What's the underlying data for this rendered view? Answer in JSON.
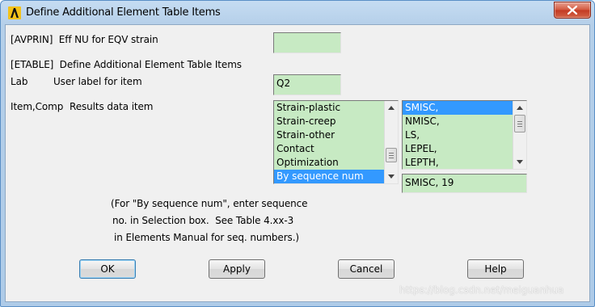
{
  "window": {
    "title": "Define Additional Element Table Items"
  },
  "avprin": {
    "label": "[AVPRIN]  Eff NU for EQV strain",
    "value": ""
  },
  "etable": {
    "label": "[ETABLE]  Define Additional Element Table Items"
  },
  "lab": {
    "key": "Lab",
    "label": "User label for item",
    "value": "Q2"
  },
  "itemcomp": {
    "key": "Item,Comp",
    "label": "Results data item",
    "left_items": [
      "Strain-plastic",
      "Strain-creep",
      "Strain-other",
      "Contact",
      "Optimization",
      "By sequence num"
    ],
    "left_selected": "By sequence num",
    "right_items": [
      "SMISC,",
      "NMISC,",
      "LS,",
      "LEPEL,",
      "LEPTH,"
    ],
    "right_selected": "SMISC,",
    "selection_value": "SMISC, 19"
  },
  "note": {
    "line1": "(For \"By sequence num\", enter sequence",
    "line2": "no. in Selection box.  See Table 4.xx-3",
    "line3": "in Elements Manual for seq. numbers.)"
  },
  "buttons": {
    "ok": "OK",
    "apply": "Apply",
    "cancel": "Cancel",
    "help": "Help"
  },
  "watermark": "https://blog.csdn.net/meiguanhua",
  "colors": {
    "field_bg": "#c7eac3",
    "selection": "#3399ff",
    "client_bg": "#f0f0f0"
  }
}
